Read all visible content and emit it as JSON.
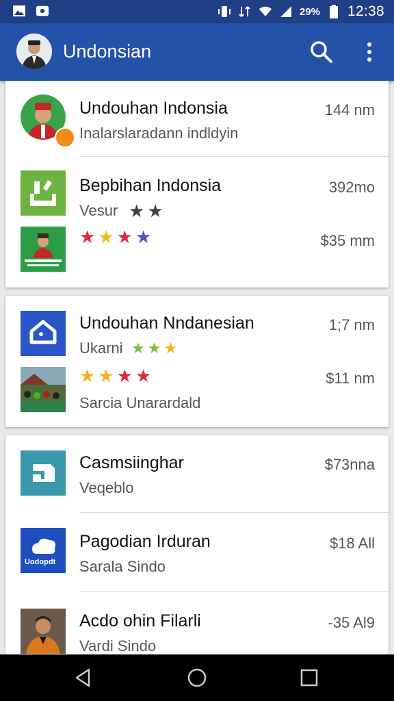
{
  "status_bar": {
    "battery_text": "29%",
    "time": "12:38",
    "icons": [
      "image-icon",
      "notification-icon",
      "vibrate-icon",
      "data-icon",
      "wifi-icon",
      "signal-icon",
      "battery-icon"
    ]
  },
  "app_bar": {
    "title": "Undonsian",
    "icons": [
      "search-icon",
      "more-vert-icon"
    ]
  },
  "cards": [
    {
      "rows": [
        {
          "title": "Undouhan Indonsia",
          "subtitle": "Inalarslaradann indldyin",
          "meta": "144 nm",
          "thumb": "avatar-man-red-hat"
        },
        {
          "title": "Bepbihan Indonsia",
          "subtitle": "Vesur",
          "meta": "392mo",
          "thumb": "green-app-icon",
          "extra_meta": "$35 mm",
          "extra_thumb": "poster-thumbnail"
        }
      ]
    },
    {
      "rows": [
        {
          "title": "Undouhan Nndanesian",
          "subtitle": "Ukarni",
          "meta": "1;7 nm",
          "thumb": "house-app-icon",
          "extra_meta": "$11 nm",
          "extra_thumb": "crowd-photo-thumbnail",
          "extra_sub": "Sarcia Unarardald"
        }
      ]
    },
    {
      "rows": [
        {
          "title": "Casmsiinghar",
          "subtitle": "Veqeblo",
          "meta": "$73nna",
          "thumb": "teal-card-app-icon"
        },
        {
          "title": "Pagodian Irduran",
          "subtitle": "Sarala Sindo",
          "meta": "$18 All",
          "thumb": "blue-cloud-app-icon",
          "thumb_label": "Uodopdt"
        },
        {
          "title": "Acdo ohin Filarli",
          "subtitle": "Vardi Sindo",
          "meta": "-35 Al9",
          "thumb": "portrait-photo-thumbnail"
        }
      ]
    }
  ],
  "nav_bar": {
    "buttons": [
      "back-icon",
      "home-icon",
      "recents-icon"
    ]
  },
  "colors": {
    "status_bar": "#1f3f86",
    "app_bar": "#2452a8",
    "star_red": "#e0283a",
    "star_yellow": "#f3b21a",
    "star_green": "#7fbf3b",
    "star_purple": "#5a4fc6"
  }
}
